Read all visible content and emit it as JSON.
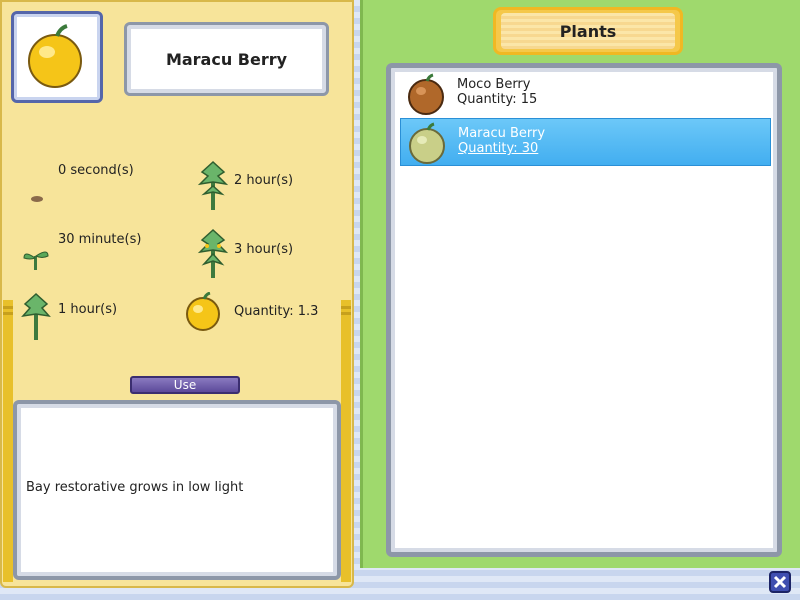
{
  "detail": {
    "name": "Maracu Berry",
    "icon": "maracu-berry-icon",
    "stages": [
      {
        "label": "0 second(s)",
        "icon": "seed-icon"
      },
      {
        "label": "2 hour(s)",
        "icon": "flowering-plant-icon"
      },
      {
        "label": "30 minute(s)",
        "icon": "sprout-icon"
      },
      {
        "label": "3 hour(s)",
        "icon": "fruiting-plant-icon"
      },
      {
        "label": "1 hour(s)",
        "icon": "young-plant-icon"
      },
      {
        "label": "Quantity: 1.3",
        "icon": "berry-yield-icon"
      }
    ],
    "use_label": "Use",
    "description": "Bay restorative grows in low light"
  },
  "list": {
    "title": "Plants",
    "items": [
      {
        "name": "Moco Berry",
        "quantity": "Quantity: 15",
        "icon": "moco-berry-icon",
        "color": "#b0682a",
        "selected": false
      },
      {
        "name": "Maracu Berry",
        "quantity": "Quantity: 30",
        "icon": "maracu-berry-icon",
        "color": "#c9cf88",
        "selected": true
      }
    ]
  },
  "colors": {
    "left_panel": "#f7e49a",
    "right_panel": "#9fd96d",
    "selection": "#42aef0",
    "use_button": "#5c4a9a"
  },
  "close_icon": "close-icon"
}
